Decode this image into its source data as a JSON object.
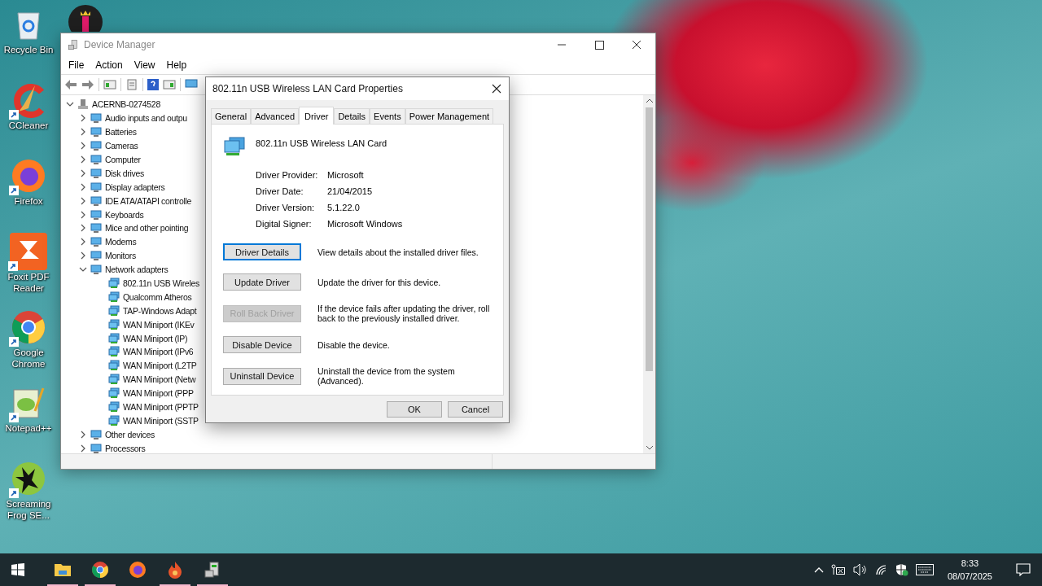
{
  "desktop_icons": [
    {
      "label": "Recycle Bin",
      "kind": "bin",
      "shortcut": false
    },
    {
      "label": "CCleaner",
      "kind": "ccleaner",
      "shortcut": true
    },
    {
      "label": "Firefox",
      "kind": "firefox",
      "shortcut": true
    },
    {
      "label": "Foxit PDF Reader",
      "kind": "foxit",
      "shortcut": true
    },
    {
      "label": "Google Chrome",
      "kind": "chrome",
      "shortcut": true
    },
    {
      "label": "Notepad++",
      "kind": "notepad",
      "shortcut": true
    },
    {
      "label": "Screaming Frog SE...",
      "kind": "frog",
      "shortcut": true
    }
  ],
  "device_manager": {
    "title": "Device Manager",
    "menu": [
      "File",
      "Action",
      "View",
      "Help"
    ],
    "tree": [
      {
        "label": "ACERNB-0274528",
        "expanded": true,
        "children": [
          {
            "label": "Audio inputs and outpu",
            "expanded": false
          },
          {
            "label": "Batteries",
            "expanded": false
          },
          {
            "label": "Cameras",
            "expanded": false
          },
          {
            "label": "Computer",
            "expanded": false
          },
          {
            "label": "Disk drives",
            "expanded": false
          },
          {
            "label": "Display adapters",
            "expanded": false
          },
          {
            "label": "IDE ATA/ATAPI controlle",
            "expanded": false
          },
          {
            "label": "Keyboards",
            "expanded": false
          },
          {
            "label": "Mice and other pointing",
            "expanded": false
          },
          {
            "label": "Modems",
            "expanded": false
          },
          {
            "label": "Monitors",
            "expanded": false
          },
          {
            "label": "Network adapters",
            "expanded": true,
            "children": [
              {
                "label": "802.11n USB Wireles"
              },
              {
                "label": "Qualcomm Atheros"
              },
              {
                "label": "TAP-Windows Adapt"
              },
              {
                "label": "WAN Miniport (IKEv"
              },
              {
                "label": "WAN Miniport (IP)"
              },
              {
                "label": "WAN Miniport (IPv6"
              },
              {
                "label": "WAN Miniport (L2TP"
              },
              {
                "label": "WAN Miniport (Netw"
              },
              {
                "label": "WAN Miniport (PPP"
              },
              {
                "label": "WAN Miniport (PPTP"
              },
              {
                "label": "WAN Miniport (SSTP"
              }
            ]
          },
          {
            "label": "Other devices",
            "expanded": false
          },
          {
            "label": "Processors",
            "expanded": false
          }
        ]
      }
    ]
  },
  "properties_dialog": {
    "title": "802.11n USB Wireless LAN Card Properties",
    "tabs": [
      {
        "label": "General",
        "selected": false
      },
      {
        "label": "Advanced",
        "selected": false
      },
      {
        "label": "Driver",
        "selected": true
      },
      {
        "label": "Details",
        "selected": false
      },
      {
        "label": "Events",
        "selected": false
      },
      {
        "label": "Power Management",
        "selected": false
      }
    ],
    "device_name": "802.11n USB Wireless LAN Card",
    "info": [
      {
        "label": "Driver Provider:",
        "value": "Microsoft"
      },
      {
        "label": "Driver Date:",
        "value": "21/04/2015"
      },
      {
        "label": "Driver Version:",
        "value": "5.1.22.0"
      },
      {
        "label": "Digital Signer:",
        "value": "Microsoft Windows"
      }
    ],
    "actions": [
      {
        "label": "Driver Details",
        "description": "View details about the installed driver files.",
        "disabled": false,
        "focused": true
      },
      {
        "label": "Update Driver",
        "description": "Update the driver for this device.",
        "disabled": false,
        "focused": false
      },
      {
        "label": "Roll Back Driver",
        "description": "If the device fails after updating the driver, roll back to the previously installed driver.",
        "disabled": true,
        "focused": false
      },
      {
        "label": "Disable Device",
        "description": "Disable the device.",
        "disabled": false,
        "focused": false
      },
      {
        "label": "Uninstall Device",
        "description": "Uninstall the device from the system (Advanced).",
        "disabled": false,
        "focused": false
      }
    ],
    "buttons": [
      "OK",
      "Cancel"
    ]
  },
  "taskbar": {
    "apps": [
      {
        "kind": "explorer",
        "running": true
      },
      {
        "kind": "chrome",
        "running": true
      },
      {
        "kind": "firefox",
        "running": false
      },
      {
        "kind": "app",
        "running": true
      },
      {
        "kind": "device",
        "running": true
      }
    ],
    "time": "8:33",
    "date": "08/07/2025"
  }
}
